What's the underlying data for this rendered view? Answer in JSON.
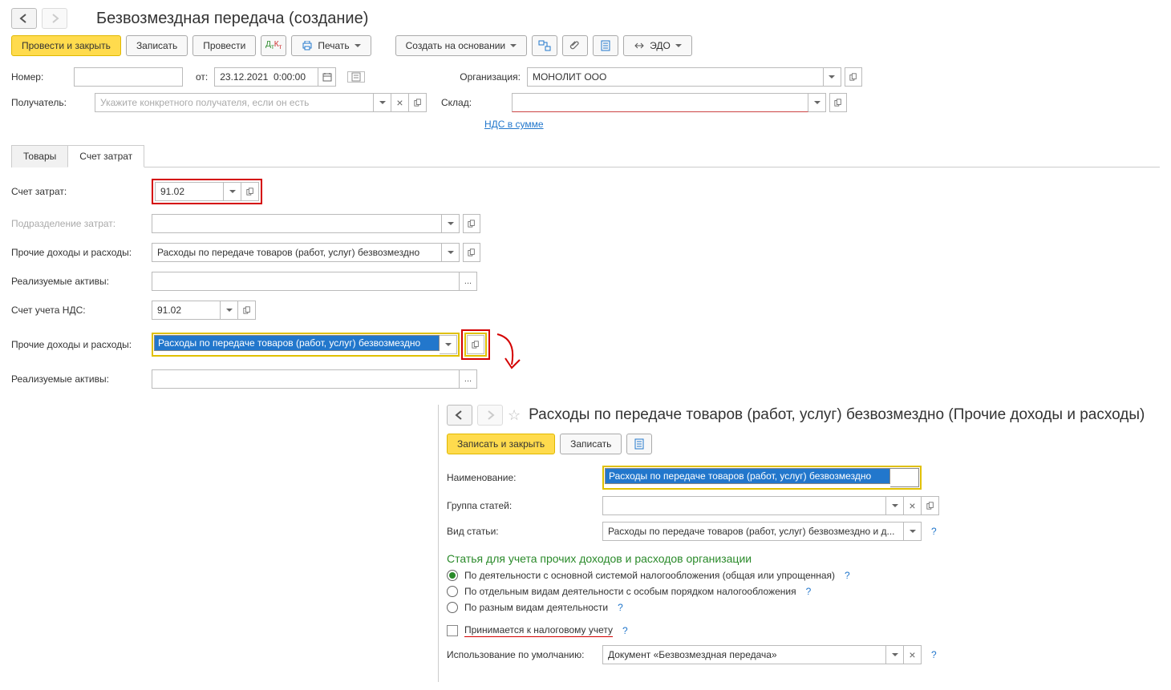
{
  "main": {
    "title": "Безвозмездная передача (создание)",
    "toolbar": {
      "post_close": "Провести и закрыть",
      "save": "Записать",
      "post": "Провести",
      "print": "Печать",
      "create_based": "Создать на основании",
      "edo": "ЭДО"
    },
    "fields": {
      "number_label": "Номер:",
      "date_label": "от:",
      "date_value": "23.12.2021  0:00:00",
      "org_label": "Организация:",
      "org_value": "МОНОЛИТ ООО",
      "recipient_label": "Получатель:",
      "recipient_placeholder": "Укажите конкретного получателя, если он есть",
      "warehouse_label": "Склад:",
      "vat_link": "НДС в сумме"
    },
    "tabs": {
      "goods": "Товары",
      "cost": "Счет затрат"
    },
    "cost": {
      "account_label": "Счет затрат:",
      "account_value": "91.02",
      "division_label": "Подразделение затрат:",
      "other_label": "Прочие доходы и расходы:",
      "other_value": "Расходы по передаче товаров (работ, услуг) безвозмездно",
      "assets_label": "Реализуемые активы:",
      "vat_account_label": "Счет учета НДС:",
      "vat_account_value": "91.02",
      "other2_label": "Прочие доходы и расходы:",
      "other2_value": "Расходы по передаче товаров (работ, услуг) безвозмездно",
      "assets2_label": "Реализуемые активы:"
    }
  },
  "detail": {
    "title": "Расходы по передаче товаров (работ, услуг) безвозмездно (Прочие доходы и расходы)",
    "toolbar": {
      "save_close": "Записать и закрыть",
      "save": "Записать"
    },
    "fields": {
      "name_label": "Наименование:",
      "name_value": "Расходы по передаче товаров (работ, услуг) безвозмездно",
      "group_label": "Группа статей:",
      "type_label": "Вид статьи:",
      "type_value": "Расходы по передаче товаров (работ, услуг) безвозмездно и д..."
    },
    "section_title": "Статья для учета прочих доходов и расходов организации",
    "radios": {
      "r1": "По деятельности с основной системой налогообложения (общая или упрощенная)",
      "r2": "По отдельным видам деятельности с особым порядком налогообложения",
      "r3": "По разным видам деятельности"
    },
    "checkbox_label": "Принимается к налоговому учету",
    "default_label": "Использование по умолчанию:",
    "default_value": "Документ «Безвозмездная передача»",
    "help": "?"
  }
}
